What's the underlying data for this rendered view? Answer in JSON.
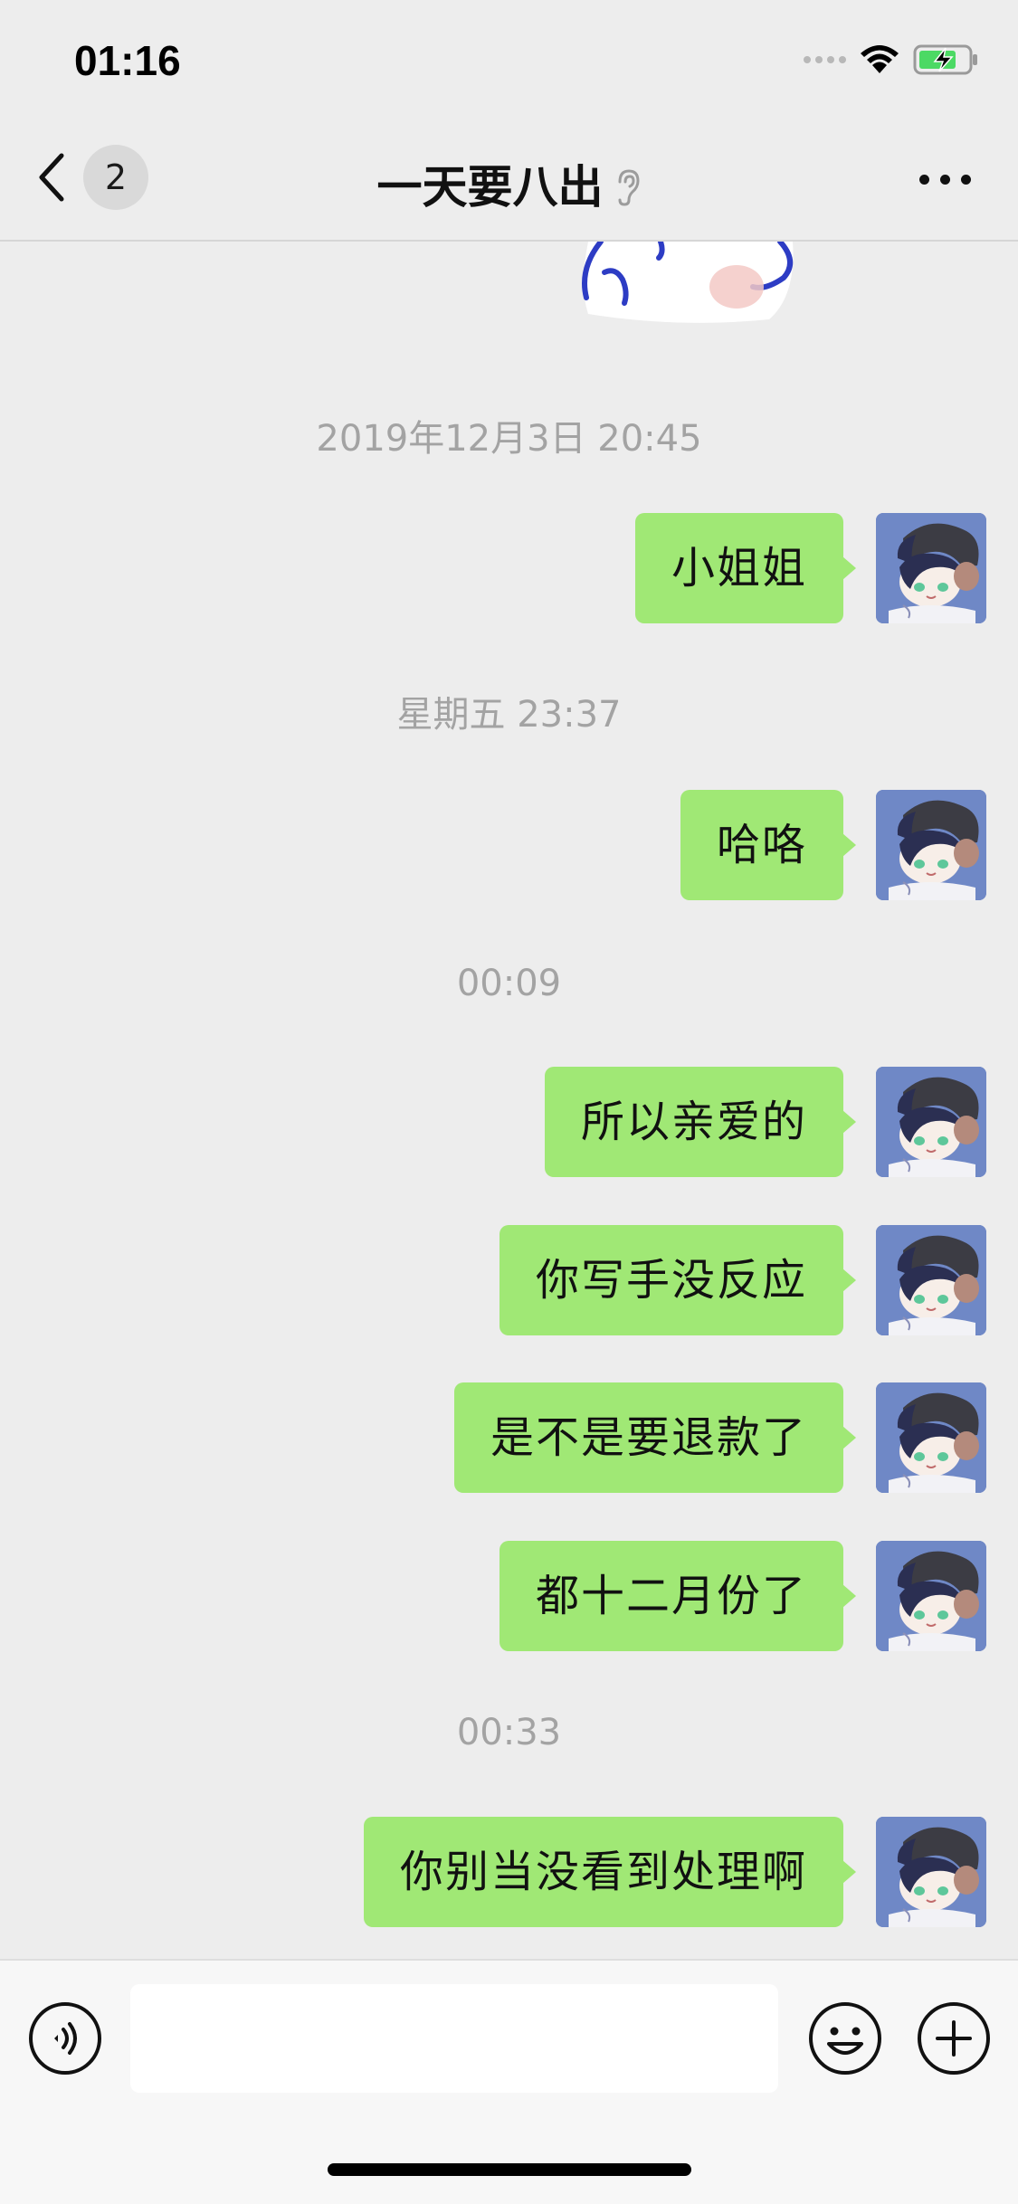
{
  "status_bar": {
    "time": "01:16"
  },
  "nav": {
    "back_count": "2",
    "title": "一天要八出"
  },
  "chat": {
    "timestamps": [
      "2019年12月3日 20:45",
      "星期五 23:37",
      "00:09",
      "00:33"
    ],
    "messages": [
      "小姐姐",
      "哈咯",
      "所以亲爱的",
      "你写手没反应",
      "是不是要退款了",
      "都十二月份了",
      "你别当没看到处理啊"
    ]
  },
  "input": {
    "value": "",
    "placeholder": ""
  },
  "colors": {
    "bubble_green": "#a0e875",
    "background": "#ededed",
    "timestamp_gray": "#a3a3a3",
    "avatar_blue": "#6f88c6"
  }
}
